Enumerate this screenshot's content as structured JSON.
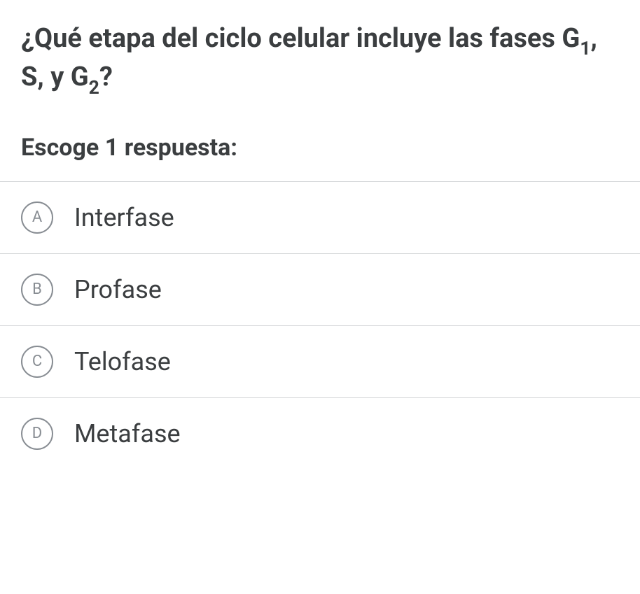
{
  "question": {
    "text_html": "¿Qué etapa del ciclo celular incluye las fases G<sub>1</sub>, S, y G<sub>2</sub>?"
  },
  "instruction": "Escoge 1 respuesta:",
  "options": [
    {
      "letter": "A",
      "label": "Interfase"
    },
    {
      "letter": "B",
      "label": "Profase"
    },
    {
      "letter": "C",
      "label": "Telofase"
    },
    {
      "letter": "D",
      "label": "Metafase"
    }
  ]
}
